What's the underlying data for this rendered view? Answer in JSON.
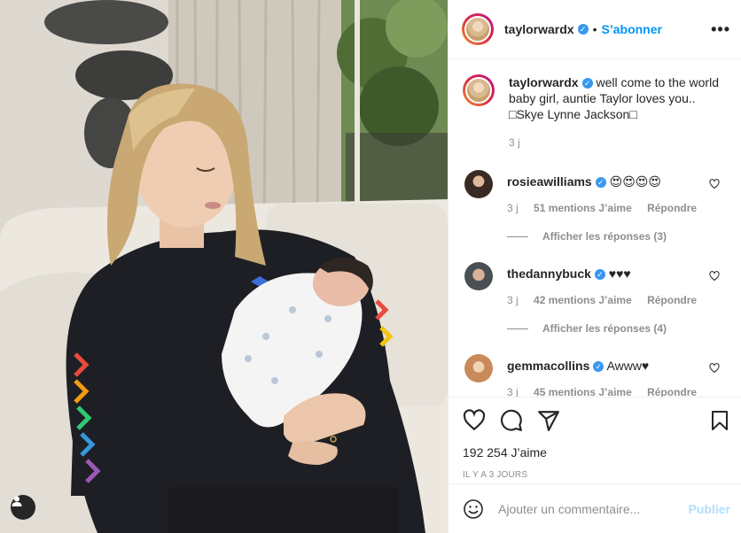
{
  "header": {
    "username": "taylorwardx",
    "separator": "•",
    "follow_label": "S’abonner",
    "more_label": "•••"
  },
  "caption": {
    "username": "taylorwardx",
    "text": "well come to the world baby girl, auntie Taylor loves you.. □Skye Lynne Jackson□",
    "time": "3 j"
  },
  "comments": [
    {
      "username": "rosieawilliams",
      "text": "😍😍😍😍",
      "time": "3 j",
      "likes": "51 mentions J’aime",
      "reply_label": "Répondre",
      "view_replies": "Afficher les réponses (3)",
      "avatar_color": "#3a2a24"
    },
    {
      "username": "thedannybuck",
      "text": "♥♥♥",
      "time": "3 j",
      "likes": "42 mentions J’aime",
      "reply_label": "Répondre",
      "view_replies": "Afficher les réponses (4)",
      "avatar_color": "#4a4f55"
    },
    {
      "username": "gemmacollins",
      "text": "Awww♥",
      "time": "3 j",
      "likes": "45 mentions J’aime",
      "reply_label": "Répondre",
      "avatar_color": "#c98a5a"
    }
  ],
  "actions": {
    "like_icon": "heart-icon",
    "comment_icon": "comment-icon",
    "share_icon": "share-icon",
    "save_icon": "bookmark-icon",
    "likes_count": "192 254",
    "likes_suffix": " J’aime",
    "age": "IL Y A 3 JOURS"
  },
  "add_comment": {
    "placeholder": "Ajouter un commentaire...",
    "publish_label": "Publier",
    "emoji_icon": "smiley-icon"
  },
  "colors": {
    "accent": "#0095f6",
    "verified": "#3897f0",
    "muted": "#8e8e8e",
    "publish_disabled": "#b2dffc"
  }
}
